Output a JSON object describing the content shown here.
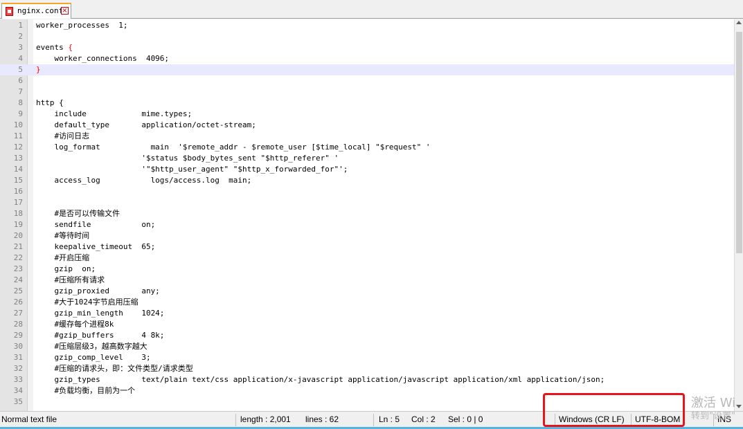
{
  "tab": {
    "filename": "nginx.conf",
    "close_glyph": "×"
  },
  "editor": {
    "active_line": 5,
    "lines": [
      {
        "n": "1",
        "text": "worker_processes  1;"
      },
      {
        "n": "2",
        "text": ""
      },
      {
        "n": "3",
        "text": "events {"
      },
      {
        "n": "4",
        "text": "    worker_connections  4096;"
      },
      {
        "n": "5",
        "text": "}"
      },
      {
        "n": "6",
        "text": ""
      },
      {
        "n": "7",
        "text": ""
      },
      {
        "n": "8",
        "text": "http {"
      },
      {
        "n": "9",
        "text": "    include            mime.types;"
      },
      {
        "n": "10",
        "text": "    default_type       application/octet-stream;"
      },
      {
        "n": "11",
        "text": "    #访问日志"
      },
      {
        "n": "12",
        "text": "    log_format           main  '$remote_addr - $remote_user [$time_local] \"$request\" '"
      },
      {
        "n": "13",
        "text": "                       '$status $body_bytes_sent \"$http_referer\" '"
      },
      {
        "n": "14",
        "text": "                       '\"$http_user_agent\" \"$http_x_forwarded_for\"';"
      },
      {
        "n": "15",
        "text": "    access_log           logs/access.log  main;"
      },
      {
        "n": "16",
        "text": ""
      },
      {
        "n": "17",
        "text": ""
      },
      {
        "n": "18",
        "text": "    #是否可以传输文件"
      },
      {
        "n": "19",
        "text": "    sendfile           on;"
      },
      {
        "n": "20",
        "text": "    #等待时间"
      },
      {
        "n": "21",
        "text": "    keepalive_timeout  65;"
      },
      {
        "n": "22",
        "text": "    #开启压缩"
      },
      {
        "n": "23",
        "text": "    gzip  on;"
      },
      {
        "n": "24",
        "text": "    #压缩所有请求"
      },
      {
        "n": "25",
        "text": "    gzip_proxied       any;"
      },
      {
        "n": "26",
        "text": "    #大于1024字节启用压缩"
      },
      {
        "n": "27",
        "text": "    gzip_min_length    1024;"
      },
      {
        "n": "28",
        "text": "    #缓存每个进程8k"
      },
      {
        "n": "29",
        "text": "    #gzip_buffers      4 8k;"
      },
      {
        "n": "30",
        "text": "    #压缩层级3，越高数字越大"
      },
      {
        "n": "31",
        "text": "    gzip_comp_level    3;"
      },
      {
        "n": "32",
        "text": "    #压缩的请求头，即：文件类型/请求类型"
      },
      {
        "n": "33",
        "text": "    gzip_types         text/plain text/css application/x-javascript application/javascript application/xml application/json;"
      },
      {
        "n": "34",
        "text": "    #负载均衡，目前为一个"
      },
      {
        "n": "35",
        "text": ""
      }
    ]
  },
  "statusbar": {
    "file_type": "Normal text file",
    "length": "length : 2,001",
    "lines": "lines : 62",
    "ln": "Ln : 5",
    "col": "Col : 2",
    "sel": "Sel : 0 | 0",
    "eol": "Windows (CR LF)",
    "encoding": "UTF-8-BOM",
    "mode": "INS"
  },
  "watermark": {
    "line1": "激活 Wi",
    "line2": "转到\"设置\""
  },
  "colors": {
    "brace": "#ff0000",
    "annotation": "#e8141c",
    "active_line": "#e8e8ff"
  }
}
